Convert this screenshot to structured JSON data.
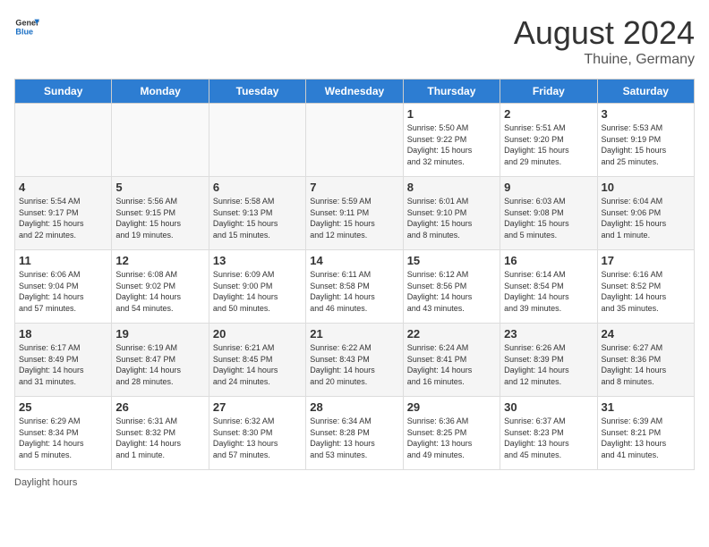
{
  "header": {
    "logo_general": "General",
    "logo_blue": "Blue",
    "month_year": "August 2024",
    "location": "Thuine, Germany"
  },
  "weekdays": [
    "Sunday",
    "Monday",
    "Tuesday",
    "Wednesday",
    "Thursday",
    "Friday",
    "Saturday"
  ],
  "weeks": [
    [
      {
        "day": "",
        "info": ""
      },
      {
        "day": "",
        "info": ""
      },
      {
        "day": "",
        "info": ""
      },
      {
        "day": "",
        "info": ""
      },
      {
        "day": "1",
        "info": "Sunrise: 5:50 AM\nSunset: 9:22 PM\nDaylight: 15 hours\nand 32 minutes."
      },
      {
        "day": "2",
        "info": "Sunrise: 5:51 AM\nSunset: 9:20 PM\nDaylight: 15 hours\nand 29 minutes."
      },
      {
        "day": "3",
        "info": "Sunrise: 5:53 AM\nSunset: 9:19 PM\nDaylight: 15 hours\nand 25 minutes."
      }
    ],
    [
      {
        "day": "4",
        "info": "Sunrise: 5:54 AM\nSunset: 9:17 PM\nDaylight: 15 hours\nand 22 minutes."
      },
      {
        "day": "5",
        "info": "Sunrise: 5:56 AM\nSunset: 9:15 PM\nDaylight: 15 hours\nand 19 minutes."
      },
      {
        "day": "6",
        "info": "Sunrise: 5:58 AM\nSunset: 9:13 PM\nDaylight: 15 hours\nand 15 minutes."
      },
      {
        "day": "7",
        "info": "Sunrise: 5:59 AM\nSunset: 9:11 PM\nDaylight: 15 hours\nand 12 minutes."
      },
      {
        "day": "8",
        "info": "Sunrise: 6:01 AM\nSunset: 9:10 PM\nDaylight: 15 hours\nand 8 minutes."
      },
      {
        "day": "9",
        "info": "Sunrise: 6:03 AM\nSunset: 9:08 PM\nDaylight: 15 hours\nand 5 minutes."
      },
      {
        "day": "10",
        "info": "Sunrise: 6:04 AM\nSunset: 9:06 PM\nDaylight: 15 hours\nand 1 minute."
      }
    ],
    [
      {
        "day": "11",
        "info": "Sunrise: 6:06 AM\nSunset: 9:04 PM\nDaylight: 14 hours\nand 57 minutes."
      },
      {
        "day": "12",
        "info": "Sunrise: 6:08 AM\nSunset: 9:02 PM\nDaylight: 14 hours\nand 54 minutes."
      },
      {
        "day": "13",
        "info": "Sunrise: 6:09 AM\nSunset: 9:00 PM\nDaylight: 14 hours\nand 50 minutes."
      },
      {
        "day": "14",
        "info": "Sunrise: 6:11 AM\nSunset: 8:58 PM\nDaylight: 14 hours\nand 46 minutes."
      },
      {
        "day": "15",
        "info": "Sunrise: 6:12 AM\nSunset: 8:56 PM\nDaylight: 14 hours\nand 43 minutes."
      },
      {
        "day": "16",
        "info": "Sunrise: 6:14 AM\nSunset: 8:54 PM\nDaylight: 14 hours\nand 39 minutes."
      },
      {
        "day": "17",
        "info": "Sunrise: 6:16 AM\nSunset: 8:52 PM\nDaylight: 14 hours\nand 35 minutes."
      }
    ],
    [
      {
        "day": "18",
        "info": "Sunrise: 6:17 AM\nSunset: 8:49 PM\nDaylight: 14 hours\nand 31 minutes."
      },
      {
        "day": "19",
        "info": "Sunrise: 6:19 AM\nSunset: 8:47 PM\nDaylight: 14 hours\nand 28 minutes."
      },
      {
        "day": "20",
        "info": "Sunrise: 6:21 AM\nSunset: 8:45 PM\nDaylight: 14 hours\nand 24 minutes."
      },
      {
        "day": "21",
        "info": "Sunrise: 6:22 AM\nSunset: 8:43 PM\nDaylight: 14 hours\nand 20 minutes."
      },
      {
        "day": "22",
        "info": "Sunrise: 6:24 AM\nSunset: 8:41 PM\nDaylight: 14 hours\nand 16 minutes."
      },
      {
        "day": "23",
        "info": "Sunrise: 6:26 AM\nSunset: 8:39 PM\nDaylight: 14 hours\nand 12 minutes."
      },
      {
        "day": "24",
        "info": "Sunrise: 6:27 AM\nSunset: 8:36 PM\nDaylight: 14 hours\nand 8 minutes."
      }
    ],
    [
      {
        "day": "25",
        "info": "Sunrise: 6:29 AM\nSunset: 8:34 PM\nDaylight: 14 hours\nand 5 minutes."
      },
      {
        "day": "26",
        "info": "Sunrise: 6:31 AM\nSunset: 8:32 PM\nDaylight: 14 hours\nand 1 minute."
      },
      {
        "day": "27",
        "info": "Sunrise: 6:32 AM\nSunset: 8:30 PM\nDaylight: 13 hours\nand 57 minutes."
      },
      {
        "day": "28",
        "info": "Sunrise: 6:34 AM\nSunset: 8:28 PM\nDaylight: 13 hours\nand 53 minutes."
      },
      {
        "day": "29",
        "info": "Sunrise: 6:36 AM\nSunset: 8:25 PM\nDaylight: 13 hours\nand 49 minutes."
      },
      {
        "day": "30",
        "info": "Sunrise: 6:37 AM\nSunset: 8:23 PM\nDaylight: 13 hours\nand 45 minutes."
      },
      {
        "day": "31",
        "info": "Sunrise: 6:39 AM\nSunset: 8:21 PM\nDaylight: 13 hours\nand 41 minutes."
      }
    ]
  ],
  "footer": {
    "note": "Daylight hours"
  }
}
